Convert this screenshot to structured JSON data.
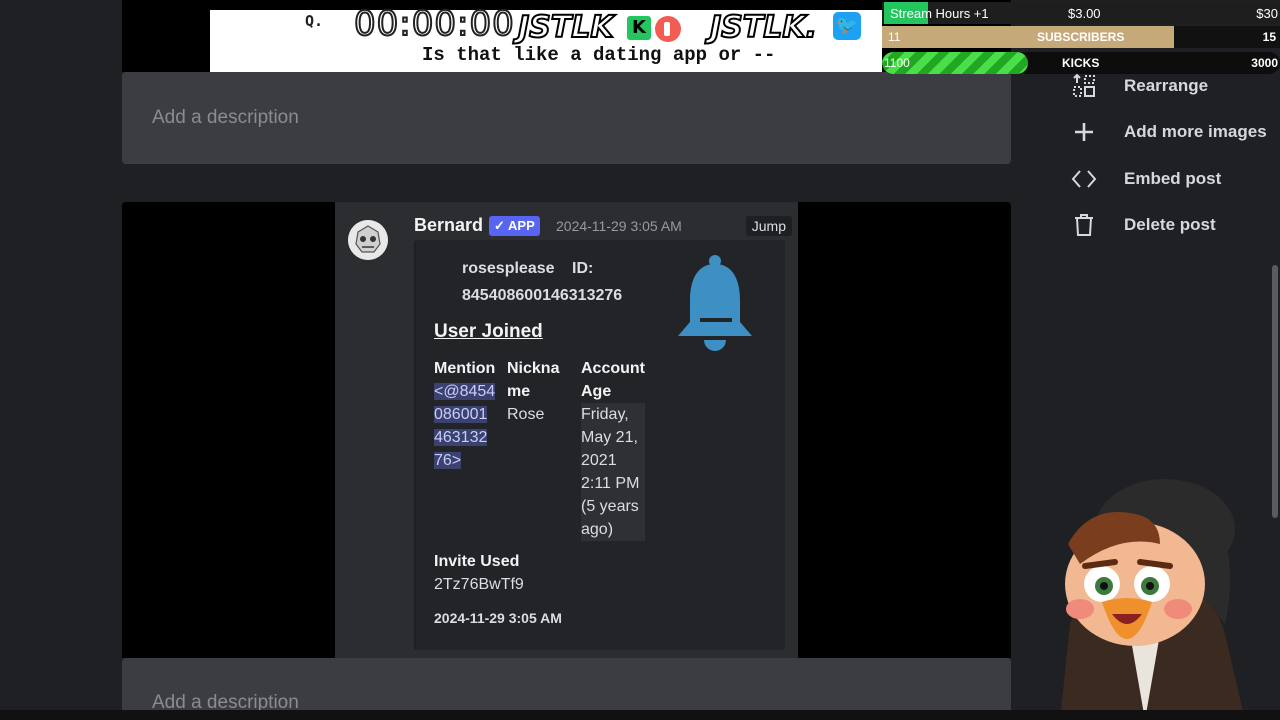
{
  "post": {
    "description_placeholder": "Add a description"
  },
  "discord_message": {
    "author": "Bernard",
    "badge": "✓ APP",
    "timestamp": "2024-11-29 3:05 AM",
    "jump_label": "Jump",
    "embed": {
      "user_line": "rosesplease",
      "id_label": "ID:",
      "id_value": "845408600146313276",
      "title": "User Joined",
      "fields": [
        {
          "name": "Mention",
          "value": "<@845408600146313276>"
        },
        {
          "name": "Nickname",
          "value": "Rose"
        },
        {
          "name": "Account Age",
          "value": "Friday, May 21, 2021 2:11 PM (5 years ago)"
        }
      ],
      "invite_label": "Invite Used",
      "invite_code": "2Tz76BwTf9",
      "footer_timestamp": "2024-11-29 3:05 AM"
    }
  },
  "stream_overlay": {
    "caption_q": "Q.",
    "caption_line": "Is that like a dating app or --",
    "timer": "00:00:00",
    "brand_1": "JSTLK",
    "brand_2": "JSTLK.",
    "kick_letter": "K",
    "goals": {
      "stream_hours_label": "Stream Hours +1",
      "stream_hours_amount": "$3.00",
      "stream_hours_target": "$30",
      "subscribers_current": "11",
      "subscribers_label": "SUBSCRIBERS",
      "subscribers_target": "15",
      "subscribers_progress": 0.733,
      "kicks_current": "1100",
      "kicks_label": "KICKS",
      "kicks_target": "3000",
      "kicks_progress": 0.367
    }
  },
  "sidebar_menu": [
    {
      "label": "Rearrange",
      "icon": "rearrange-icon"
    },
    {
      "label": "Add more images",
      "icon": "plus-icon"
    },
    {
      "label": "Embed post",
      "icon": "code-icon"
    },
    {
      "label": "Delete post",
      "icon": "trash-icon"
    }
  ],
  "colors": {
    "accent_app_badge": "#5865f2",
    "bell": "#3d8fc4",
    "kicks_green": "#4ade4a",
    "subs_gold": "#c5a978"
  }
}
